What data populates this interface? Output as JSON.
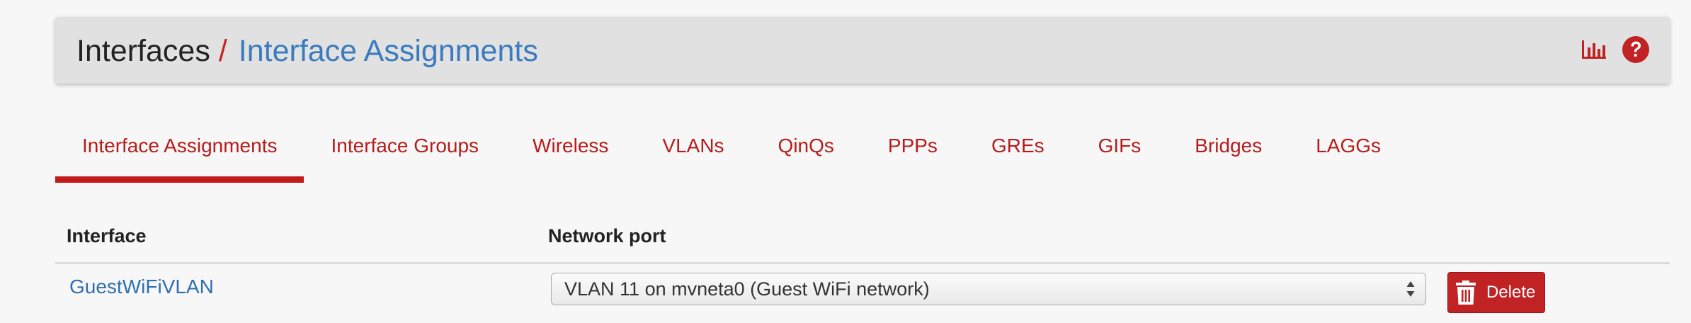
{
  "breadcrumb": {
    "parent": "Interfaces",
    "separator": "/",
    "current": "Interface Assignments"
  },
  "header_icons": [
    {
      "icon": "bar-chart-icon",
      "label": "Status"
    },
    {
      "icon": "help-icon",
      "label": "Help"
    }
  ],
  "tabs": [
    {
      "label": "Interface Assignments",
      "active": true
    },
    {
      "label": "Interface Groups",
      "active": false
    },
    {
      "label": "Wireless",
      "active": false
    },
    {
      "label": "VLANs",
      "active": false
    },
    {
      "label": "QinQs",
      "active": false
    },
    {
      "label": "PPPs",
      "active": false
    },
    {
      "label": "GREs",
      "active": false
    },
    {
      "label": "GIFs",
      "active": false
    },
    {
      "label": "Bridges",
      "active": false
    },
    {
      "label": "LAGGs",
      "active": false
    }
  ],
  "table": {
    "headers": {
      "interface": "Interface",
      "network_port": "Network port"
    },
    "rows": [
      {
        "interface": "GuestWiFiVLAN",
        "network_port": "VLAN 11 on mvneta0 (Guest WiFi network)",
        "delete_label": "Delete"
      }
    ]
  },
  "colors": {
    "accent_red": "#c12325",
    "link_blue": "#2f6fb0",
    "header_bg": "#e1e1e1",
    "page_bg": "#f7f7f7"
  }
}
